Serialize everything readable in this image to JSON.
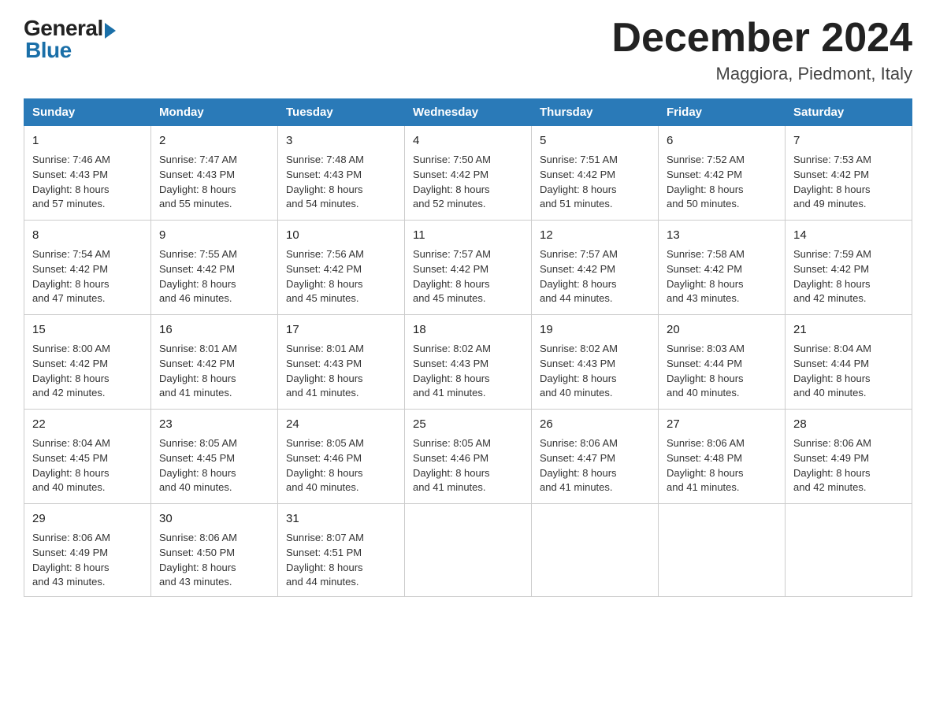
{
  "header": {
    "logo_general": "General",
    "logo_blue": "Blue",
    "title": "December 2024",
    "location": "Maggiora, Piedmont, Italy"
  },
  "days_of_week": [
    "Sunday",
    "Monday",
    "Tuesday",
    "Wednesday",
    "Thursday",
    "Friday",
    "Saturday"
  ],
  "weeks": [
    [
      {
        "day": "1",
        "sunrise": "7:46 AM",
        "sunset": "4:43 PM",
        "daylight": "8 hours and 57 minutes."
      },
      {
        "day": "2",
        "sunrise": "7:47 AM",
        "sunset": "4:43 PM",
        "daylight": "8 hours and 55 minutes."
      },
      {
        "day": "3",
        "sunrise": "7:48 AM",
        "sunset": "4:43 PM",
        "daylight": "8 hours and 54 minutes."
      },
      {
        "day": "4",
        "sunrise": "7:50 AM",
        "sunset": "4:42 PM",
        "daylight": "8 hours and 52 minutes."
      },
      {
        "day": "5",
        "sunrise": "7:51 AM",
        "sunset": "4:42 PM",
        "daylight": "8 hours and 51 minutes."
      },
      {
        "day": "6",
        "sunrise": "7:52 AM",
        "sunset": "4:42 PM",
        "daylight": "8 hours and 50 minutes."
      },
      {
        "day": "7",
        "sunrise": "7:53 AM",
        "sunset": "4:42 PM",
        "daylight": "8 hours and 49 minutes."
      }
    ],
    [
      {
        "day": "8",
        "sunrise": "7:54 AM",
        "sunset": "4:42 PM",
        "daylight": "8 hours and 47 minutes."
      },
      {
        "day": "9",
        "sunrise": "7:55 AM",
        "sunset": "4:42 PM",
        "daylight": "8 hours and 46 minutes."
      },
      {
        "day": "10",
        "sunrise": "7:56 AM",
        "sunset": "4:42 PM",
        "daylight": "8 hours and 45 minutes."
      },
      {
        "day": "11",
        "sunrise": "7:57 AM",
        "sunset": "4:42 PM",
        "daylight": "8 hours and 45 minutes."
      },
      {
        "day": "12",
        "sunrise": "7:57 AM",
        "sunset": "4:42 PM",
        "daylight": "8 hours and 44 minutes."
      },
      {
        "day": "13",
        "sunrise": "7:58 AM",
        "sunset": "4:42 PM",
        "daylight": "8 hours and 43 minutes."
      },
      {
        "day": "14",
        "sunrise": "7:59 AM",
        "sunset": "4:42 PM",
        "daylight": "8 hours and 42 minutes."
      }
    ],
    [
      {
        "day": "15",
        "sunrise": "8:00 AM",
        "sunset": "4:42 PM",
        "daylight": "8 hours and 42 minutes."
      },
      {
        "day": "16",
        "sunrise": "8:01 AM",
        "sunset": "4:42 PM",
        "daylight": "8 hours and 41 minutes."
      },
      {
        "day": "17",
        "sunrise": "8:01 AM",
        "sunset": "4:43 PM",
        "daylight": "8 hours and 41 minutes."
      },
      {
        "day": "18",
        "sunrise": "8:02 AM",
        "sunset": "4:43 PM",
        "daylight": "8 hours and 41 minutes."
      },
      {
        "day": "19",
        "sunrise": "8:02 AM",
        "sunset": "4:43 PM",
        "daylight": "8 hours and 40 minutes."
      },
      {
        "day": "20",
        "sunrise": "8:03 AM",
        "sunset": "4:44 PM",
        "daylight": "8 hours and 40 minutes."
      },
      {
        "day": "21",
        "sunrise": "8:04 AM",
        "sunset": "4:44 PM",
        "daylight": "8 hours and 40 minutes."
      }
    ],
    [
      {
        "day": "22",
        "sunrise": "8:04 AM",
        "sunset": "4:45 PM",
        "daylight": "8 hours and 40 minutes."
      },
      {
        "day": "23",
        "sunrise": "8:05 AM",
        "sunset": "4:45 PM",
        "daylight": "8 hours and 40 minutes."
      },
      {
        "day": "24",
        "sunrise": "8:05 AM",
        "sunset": "4:46 PM",
        "daylight": "8 hours and 40 minutes."
      },
      {
        "day": "25",
        "sunrise": "8:05 AM",
        "sunset": "4:46 PM",
        "daylight": "8 hours and 41 minutes."
      },
      {
        "day": "26",
        "sunrise": "8:06 AM",
        "sunset": "4:47 PM",
        "daylight": "8 hours and 41 minutes."
      },
      {
        "day": "27",
        "sunrise": "8:06 AM",
        "sunset": "4:48 PM",
        "daylight": "8 hours and 41 minutes."
      },
      {
        "day": "28",
        "sunrise": "8:06 AM",
        "sunset": "4:49 PM",
        "daylight": "8 hours and 42 minutes."
      }
    ],
    [
      {
        "day": "29",
        "sunrise": "8:06 AM",
        "sunset": "4:49 PM",
        "daylight": "8 hours and 43 minutes."
      },
      {
        "day": "30",
        "sunrise": "8:06 AM",
        "sunset": "4:50 PM",
        "daylight": "8 hours and 43 minutes."
      },
      {
        "day": "31",
        "sunrise": "8:07 AM",
        "sunset": "4:51 PM",
        "daylight": "8 hours and 44 minutes."
      },
      null,
      null,
      null,
      null
    ]
  ],
  "labels": {
    "sunrise": "Sunrise:",
    "sunset": "Sunset:",
    "daylight": "Daylight:"
  }
}
